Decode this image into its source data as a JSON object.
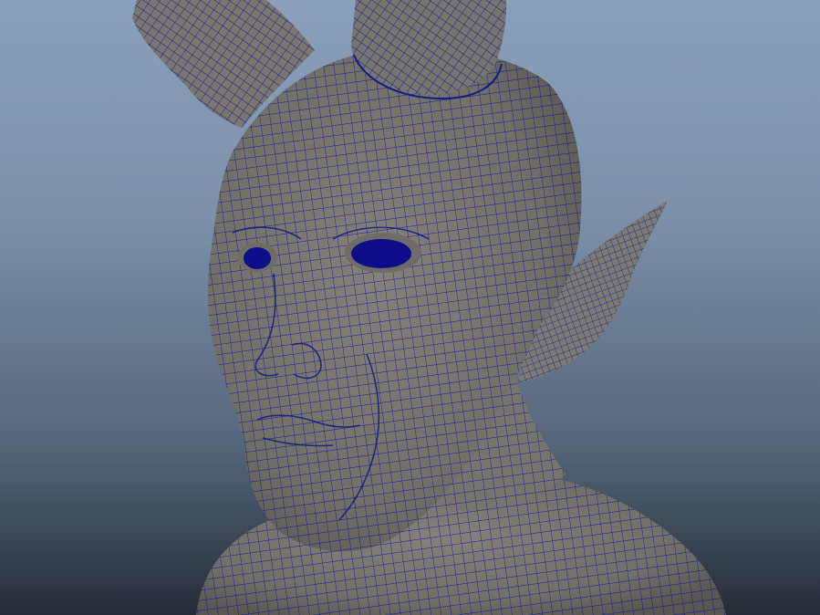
{
  "viewport": {
    "background_top": "#8aa0bb",
    "background_bottom": "#262c36"
  },
  "model": {
    "surface_color": "#7a7670",
    "surface_shade": "#5f5b56",
    "wireframe_color": "#101a8c",
    "eye_color": "#0d0d8a"
  }
}
